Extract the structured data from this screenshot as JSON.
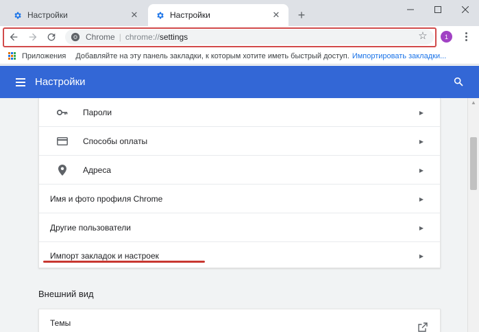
{
  "tabs": [
    {
      "title": "Настройки",
      "active": false
    },
    {
      "title": "Настройки",
      "active": true
    }
  ],
  "window": {
    "minimize_icon": "minimize-icon",
    "maximize_icon": "maximize-icon",
    "close_icon": "close-icon"
  },
  "omnibox": {
    "chip": "Chrome",
    "url_scheme": "chrome://",
    "url_path": "settings"
  },
  "profile": {
    "initial": "1",
    "color": "#a142c4"
  },
  "bookmarks_bar": {
    "apps_label": "Приложения",
    "hint": "Добавляйте на эту панель закладки, к которым хотите иметь быстрый доступ.",
    "import_link": "Импортировать закладки..."
  },
  "header": {
    "title": "Настройки",
    "color": "#3367d6"
  },
  "autofill": {
    "items": [
      {
        "label": "Пароли",
        "icon": "key-icon"
      },
      {
        "label": "Способы оплаты",
        "icon": "credit-card-icon"
      },
      {
        "label": "Адреса",
        "icon": "location-pin-icon"
      }
    ]
  },
  "people": {
    "items": [
      {
        "label": "Имя и фото профиля Chrome"
      },
      {
        "label": "Другие пользователи"
      },
      {
        "label": "Импорт закладок и настроек"
      }
    ]
  },
  "appearance": {
    "section_title": "Внешний вид",
    "themes_label": "Темы"
  },
  "annotation_color": "#c8372f"
}
